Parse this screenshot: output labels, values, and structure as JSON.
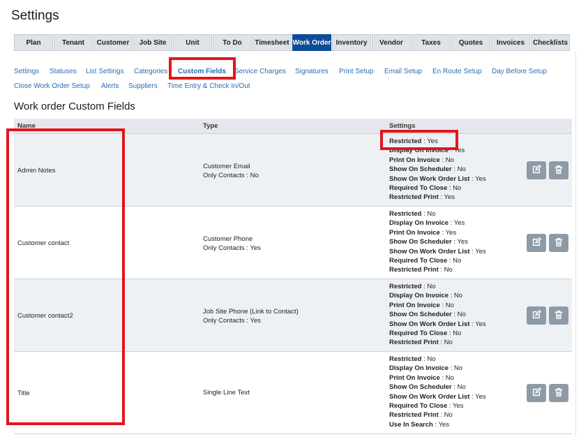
{
  "page": {
    "title": "Settings"
  },
  "top_tabs": [
    "Plan",
    "Tenant",
    "Customer",
    "Job Site",
    "Unit",
    "To Do",
    "Timesheet",
    "Work Order",
    "Inventory",
    "Vendor",
    "Taxes",
    "Quotes",
    "Invoices",
    "Checklists"
  ],
  "active_top_tab": "Work Order",
  "sub_links": [
    "Settings",
    "Statuses",
    "List Settings",
    "Categories",
    "Custom Fields",
    "Service Charges",
    "Signatures",
    "Print Setup",
    "Email Setup",
    "En Route Setup",
    "Day Before Setup",
    "Close Work Order Setup",
    "Alerts",
    "Suppliers",
    "Time Entry & Check In/Out"
  ],
  "active_sub_link": "Custom Fields",
  "section_title": "Work order Custom Fields",
  "table": {
    "headers": {
      "name": "Name",
      "type": "Type",
      "settings": "Settings"
    },
    "rows": [
      {
        "name": "Admin Notes",
        "type": [
          "Customer Email",
          "Only Contacts : No"
        ],
        "settings": [
          [
            "Restricted",
            "Yes"
          ],
          [
            "Display On Invoice",
            "Yes"
          ],
          [
            "Print On Invoice",
            "No"
          ],
          [
            "Show On Scheduler",
            "No"
          ],
          [
            "Show On Work Order List",
            "Yes"
          ],
          [
            "Required To Close",
            "No"
          ],
          [
            "Restricted Print",
            "Yes"
          ]
        ]
      },
      {
        "name": "Customer contact",
        "type": [
          "Customer Phone",
          "Only Contacts : Yes"
        ],
        "settings": [
          [
            "Restricted",
            "No"
          ],
          [
            "Display On Invoice",
            "Yes"
          ],
          [
            "Print On Invoice",
            "Yes"
          ],
          [
            "Show On Scheduler",
            "Yes"
          ],
          [
            "Show On Work Order List",
            "Yes"
          ],
          [
            "Required To Close",
            "No"
          ],
          [
            "Restricted Print",
            "No"
          ]
        ]
      },
      {
        "name": "Customer contact2",
        "type": [
          "Job Site Phone (Link to Contact)",
          "Only Contacts : Yes"
        ],
        "settings": [
          [
            "Restricted",
            "No"
          ],
          [
            "Display On Invoice",
            "No"
          ],
          [
            "Print On Invoice",
            "No"
          ],
          [
            "Show On Scheduler",
            "No"
          ],
          [
            "Show On Work Order List",
            "Yes"
          ],
          [
            "Required To Close",
            "No"
          ],
          [
            "Restricted Print",
            "No"
          ]
        ]
      },
      {
        "name": "Title",
        "type": [
          "Single Line Text"
        ],
        "settings": [
          [
            "Restricted",
            "No"
          ],
          [
            "Display On Invoice",
            "No"
          ],
          [
            "Print On Invoice",
            "No"
          ],
          [
            "Show On Scheduler",
            "No"
          ],
          [
            "Show On Work Order List",
            "Yes"
          ],
          [
            "Required To Close",
            "Yes"
          ],
          [
            "Restricted Print",
            "No"
          ],
          [
            "Use In Search",
            "Yes"
          ]
        ]
      }
    ]
  },
  "icons": {
    "edit": "edit-icon",
    "delete": "trash-icon"
  },
  "colors": {
    "active_tab": "#0d4c97",
    "link": "#2b6cb0",
    "annotation": "#e0161e",
    "action_button": "#8e9ba7"
  }
}
